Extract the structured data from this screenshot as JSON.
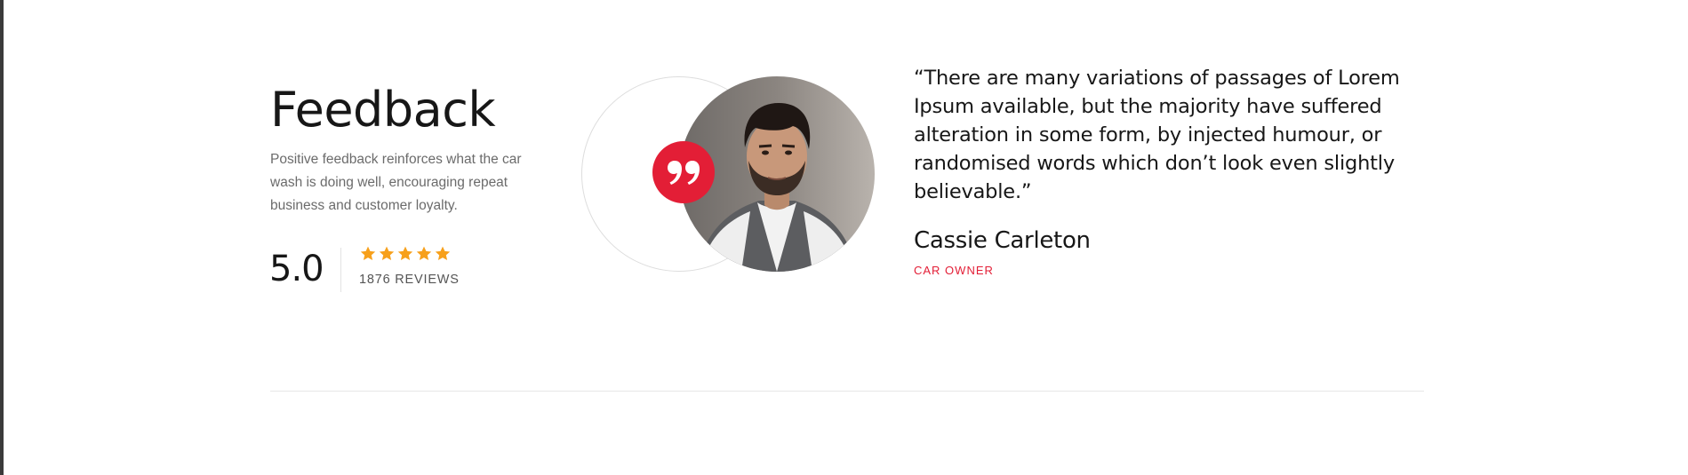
{
  "feedback": {
    "title": "Feedback",
    "description": "Positive feedback reinforces what the car wash is doing well, encouraging repeat business and customer loyalty.",
    "rating": "5.0",
    "stars": 5,
    "star_color": "#f7a01b",
    "reviews_label": "1876 REVIEWS"
  },
  "testimonial": {
    "quote": "“There are many variations of passages of Lorem Ipsum available, but the majority have suffered alteration in some form, by injected humour, or randomised words which don’t look even slightly believable.”",
    "author_name": "Cassie Carleton",
    "author_role": "CAR OWNER",
    "quote_icon": "quote-icon",
    "accent_color": "#e31e36"
  }
}
